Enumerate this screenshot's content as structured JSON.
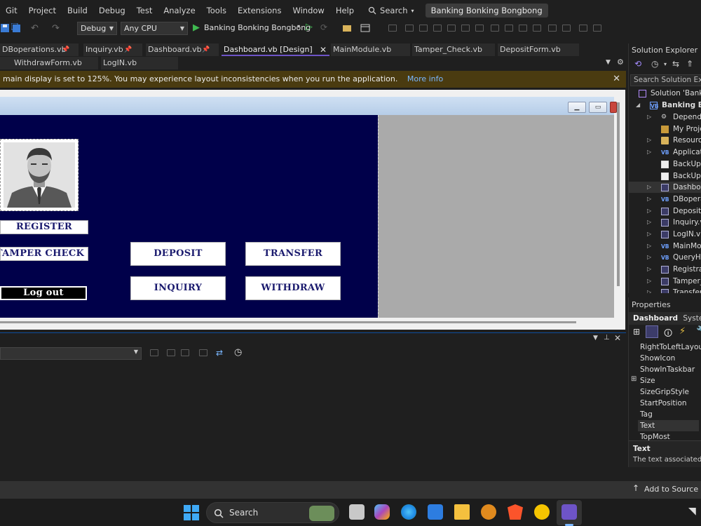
{
  "menubar": {
    "items": [
      "Git",
      "Project",
      "Build",
      "Debug",
      "Test",
      "Analyze",
      "Tools",
      "Extensions",
      "Window",
      "Help"
    ],
    "search_label": "Search",
    "solution_title": "Banking Bonking Bongbong"
  },
  "toolbar": {
    "config": "Debug",
    "platform": "Any CPU",
    "run_target": "Banking Bonking Bongbong"
  },
  "tabs_row1": [
    {
      "label": "DBoperations.vb"
    },
    {
      "label": "Inquiry.vb"
    },
    {
      "label": "Dashboard.vb"
    },
    {
      "label": "Dashboard.vb [Design]",
      "active": true
    },
    {
      "label": "MainModule.vb"
    },
    {
      "label": "Tamper_Check.vb"
    },
    {
      "label": "DepositForm.vb"
    }
  ],
  "tabs_row2": [
    {
      "label": "WithdrawForm.vb"
    },
    {
      "label": "LogIN.vb"
    }
  ],
  "infobar": {
    "message": "main display is set to 125%. You may experience layout inconsistencies when you run the application.",
    "link": "More info"
  },
  "form": {
    "buttons": {
      "register": "REGISTER",
      "tamper_check": "TAMPER CHECK",
      "logout": "Log out",
      "deposit": "DEPOSIT",
      "transfer": "TRANSFER",
      "inquiry": "INQUIRY",
      "withdraw": "WITHDRAW"
    }
  },
  "solution_explorer": {
    "title": "Solution Explorer",
    "search_placeholder": "Search Solution Explo",
    "items": [
      {
        "label": "Solution 'Banking",
        "icon": "solution-icon"
      },
      {
        "label": "Banking Bo",
        "icon": "vb-project-icon"
      },
      {
        "label": "Depende",
        "icon": "dependencies-icon"
      },
      {
        "label": "My Proje",
        "icon": "wrench-icon"
      },
      {
        "label": "Resource",
        "icon": "folder-icon"
      },
      {
        "label": "Applicati",
        "icon": "vb-file-icon"
      },
      {
        "label": "BackUp T",
        "icon": "file-icon"
      },
      {
        "label": "BackUp T",
        "icon": "file-icon"
      },
      {
        "label": "Dashboa",
        "icon": "form-icon"
      },
      {
        "label": "DBopera",
        "icon": "vb-file-icon"
      },
      {
        "label": "DepositF",
        "icon": "form-icon"
      },
      {
        "label": "Inquiry.v",
        "icon": "form-icon"
      },
      {
        "label": "LogIN.vb",
        "icon": "form-icon"
      },
      {
        "label": "MainMou",
        "icon": "vb-file-icon"
      },
      {
        "label": "QueryHa",
        "icon": "vb-file-icon"
      },
      {
        "label": "Registrat",
        "icon": "form-icon"
      },
      {
        "label": "Tamper_C",
        "icon": "form-icon"
      },
      {
        "label": "Transfer.v",
        "icon": "form-icon"
      }
    ]
  },
  "properties": {
    "title": "Properties",
    "object_name": "Dashboard",
    "object_type": "System.W",
    "rows": [
      "RightToLeftLayout",
      "ShowIcon",
      "ShowInTaskbar",
      "Size",
      "SizeGripStyle",
      "StartPosition",
      "Tag",
      "Text",
      "TopMost"
    ],
    "desc_title": "Text",
    "desc_text": "The text associated w"
  },
  "statusbar": {
    "source_control": "Add to Source Co"
  },
  "taskbar": {
    "search_label": "Search"
  }
}
